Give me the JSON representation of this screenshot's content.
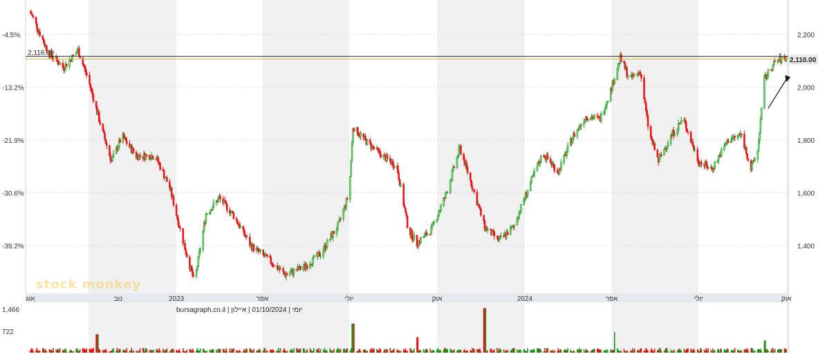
{
  "chart_data": {
    "type": "candlestick",
    "title": "",
    "caption": "יומי | 01/10/2024 | איילון | bursagraph.co.il",
    "watermark": "stock monkey",
    "y_right_ticks": [
      "2,200",
      "2,000",
      "1,800",
      "1,600",
      "1,400"
    ],
    "y_right_tick_values": [
      2200,
      2000,
      1800,
      1600,
      1400
    ],
    "y_left_ticks": [
      "-4.5%",
      "-13.2%",
      "-21.9%",
      "-30.6%",
      "-39.2%"
    ],
    "ylim": [
      1220,
      2330
    ],
    "x_tick_labels": [
      "אוג",
      "נוב",
      "2023",
      "אפר",
      "יולי",
      "אוק",
      "2024",
      "אפר",
      "יולי",
      "אוק"
    ],
    "reference_lines": {
      "left_label": "2,116.89",
      "left_value": 2116.89,
      "last_price_label": "2,110.00",
      "last_price_value": 2110
    },
    "price_path": [
      [
        "2022-08-01",
        2285
      ],
      [
        "2022-08-20",
        2130
      ],
      [
        "2022-09-05",
        2075
      ],
      [
        "2022-09-20",
        2140
      ],
      [
        "2022-10-01",
        2025
      ],
      [
        "2022-10-15",
        1840
      ],
      [
        "2022-10-25",
        1720
      ],
      [
        "2022-11-05",
        1815
      ],
      [
        "2022-11-20",
        1740
      ],
      [
        "2022-12-10",
        1740
      ],
      [
        "2022-12-25",
        1620
      ],
      [
        "2023-01-10",
        1390
      ],
      [
        "2023-01-20",
        1260
      ],
      [
        "2023-02-01",
        1520
      ],
      [
        "2023-02-15",
        1580
      ],
      [
        "2023-03-01",
        1520
      ],
      [
        "2023-03-20",
        1400
      ],
      [
        "2023-04-10",
        1340
      ],
      [
        "2023-04-25",
        1290
      ],
      [
        "2023-05-15",
        1320
      ],
      [
        "2023-06-01",
        1370
      ],
      [
        "2023-06-20",
        1480
      ],
      [
        "2023-07-01",
        1600
      ],
      [
        "2023-07-05",
        1850
      ],
      [
        "2023-07-20",
        1790
      ],
      [
        "2023-08-05",
        1740
      ],
      [
        "2023-08-20",
        1700
      ],
      [
        "2023-09-01",
        1460
      ],
      [
        "2023-09-10",
        1410
      ],
      [
        "2023-09-25",
        1460
      ],
      [
        "2023-10-10",
        1590
      ],
      [
        "2023-10-25",
        1770
      ],
      [
        "2023-11-10",
        1590
      ],
      [
        "2023-11-20",
        1470
      ],
      [
        "2023-12-05",
        1420
      ],
      [
        "2023-12-20",
        1470
      ],
      [
        "2024-01-05",
        1620
      ],
      [
        "2024-01-20",
        1750
      ],
      [
        "2024-02-05",
        1680
      ],
      [
        "2024-02-20",
        1810
      ],
      [
        "2024-03-05",
        1890
      ],
      [
        "2024-03-20",
        1880
      ],
      [
        "2024-04-01",
        2000
      ],
      [
        "2024-04-10",
        2110
      ],
      [
        "2024-04-20",
        2030
      ],
      [
        "2024-05-01",
        2060
      ],
      [
        "2024-05-10",
        1830
      ],
      [
        "2024-05-20",
        1720
      ],
      [
        "2024-06-01",
        1810
      ],
      [
        "2024-06-15",
        1880
      ],
      [
        "2024-07-01",
        1720
      ],
      [
        "2024-07-15",
        1690
      ],
      [
        "2024-08-01",
        1800
      ],
      [
        "2024-08-15",
        1820
      ],
      [
        "2024-08-25",
        1690
      ],
      [
        "2024-09-01",
        1760
      ],
      [
        "2024-09-08",
        2030
      ],
      [
        "2024-09-20",
        2100
      ],
      [
        "2024-10-01",
        2110
      ]
    ],
    "volume_ticks": [
      "1,466",
      "722"
    ],
    "volume_tick_values": [
      1466,
      722
    ],
    "volume_spikes": [
      [
        "2023-07-05",
        980
      ],
      [
        "2023-11-20",
        1500
      ],
      [
        "2022-10-10",
        620
      ],
      [
        "2024-04-05",
        700
      ],
      [
        "2023-09-10",
        520
      ],
      [
        "2024-09-08",
        410
      ]
    ],
    "colors": {
      "up": "#1a9c1a",
      "down": "#e8161a",
      "up_volume": "#188f18",
      "down_volume": "#e21010",
      "ref_line_dark": "#2b2b2b",
      "ref_line_gold": "#d8b24a",
      "band": "#f0f0f0",
      "grid": "#d9d9d9"
    }
  }
}
